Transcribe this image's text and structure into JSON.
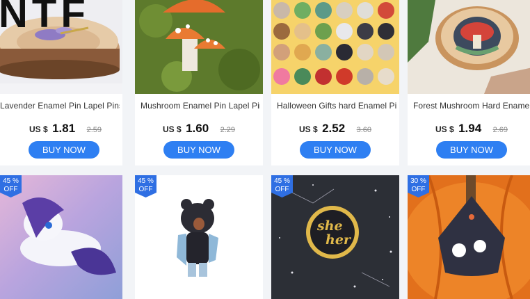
{
  "currency": "US $",
  "buy_label": "BUY NOW",
  "products": [
    {
      "title": "Lavender Enamel Pin Lapel Pins",
      "price": "1.81",
      "old_price": "2.59",
      "thumb_text": "NTF"
    },
    {
      "title": "Mushroom Enamel Pin Lapel Pins",
      "price": "1.60",
      "old_price": "2.29"
    },
    {
      "title": "Halloween Gifts hard Enamel Pins",
      "price": "2.52",
      "old_price": "3.60"
    },
    {
      "title": "Forest Mushroom Hard Enamel",
      "price": "1.94",
      "old_price": "2.69"
    }
  ],
  "discounted": [
    {
      "discount": "45 %",
      "off": "OFF"
    },
    {
      "discount": "45 %",
      "off": "OFF"
    },
    {
      "discount": "45 %",
      "off": "OFF",
      "pin_text_1": "she",
      "pin_text_2": "her"
    },
    {
      "discount": "30 %",
      "off": "OFF"
    }
  ]
}
